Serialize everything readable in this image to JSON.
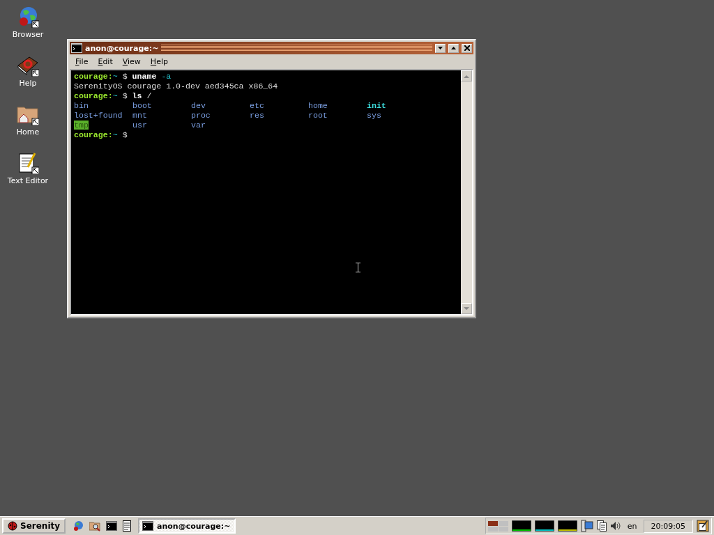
{
  "desktop_icons": [
    {
      "label": "Browser",
      "kind": "globe"
    },
    {
      "label": "Help",
      "kind": "book"
    },
    {
      "label": "Home",
      "kind": "folder"
    },
    {
      "label": "Text Editor",
      "kind": "notepad"
    }
  ],
  "window": {
    "title": "anon@courage:~",
    "menu": [
      "File",
      "Edit",
      "View",
      "Help"
    ],
    "terminal": {
      "lines": [
        [
          {
            "text": "courage:",
            "kind": "host"
          },
          {
            "text": "~",
            "kind": "path"
          },
          {
            "text": "$",
            "kind": "plain"
          },
          {
            "text": "uname",
            "kind": "command"
          },
          {
            "text": "-a",
            "kind": "arg"
          }
        ],
        [
          {
            "text": "SerenityOS courage 1.0-dev aed345ca x86_64",
            "kind": "plain"
          }
        ],
        [
          {
            "text": "courage:",
            "kind": "host"
          },
          {
            "text": "~",
            "kind": "path"
          },
          {
            "text": "$",
            "kind": "plain"
          },
          {
            "text": "ls",
            "kind": "command"
          },
          {
            "text": "/",
            "kind": "plain"
          }
        ],
        [
          {
            "text": "courage:",
            "kind": "host"
          },
          {
            "text": "~",
            "kind": "path"
          },
          {
            "text": "$",
            "kind": "plain"
          }
        ]
      ],
      "listing": [
        [
          {
            "text": "bin",
            "kind": "dir"
          },
          {
            "text": "boot",
            "kind": "dir"
          },
          {
            "text": "dev",
            "kind": "dir"
          },
          {
            "text": "etc",
            "kind": "dir"
          },
          {
            "text": "home",
            "kind": "dir"
          },
          {
            "text": "init",
            "kind": "exec"
          }
        ],
        [
          {
            "text": "lost+found",
            "kind": "dir"
          },
          {
            "text": "mnt",
            "kind": "dir"
          },
          {
            "text": "proc",
            "kind": "dir"
          },
          {
            "text": "res",
            "kind": "dir"
          },
          {
            "text": "root",
            "kind": "dir"
          },
          {
            "text": "sys",
            "kind": "dir"
          }
        ],
        [
          {
            "text": "tmp",
            "kind": "sticky"
          },
          {
            "text": "usr",
            "kind": "dir"
          },
          {
            "text": "var",
            "kind": "dir"
          }
        ]
      ]
    }
  },
  "taskbar": {
    "start": "Serenity",
    "quick_launch": [
      {
        "kind": "globe"
      },
      {
        "kind": "finder"
      },
      {
        "kind": "terminal"
      },
      {
        "kind": "notepad"
      }
    ],
    "tasks": [
      {
        "label": "anon@courage:~",
        "selected": true
      }
    ],
    "workspaces": [
      {
        "selected": true
      },
      {
        "selected": false
      },
      {
        "selected": false
      },
      {
        "selected": false
      }
    ],
    "graphs": [
      {
        "color": "#00c000"
      },
      {
        "color": "#00c0c0"
      },
      {
        "color": "#c0c000"
      }
    ],
    "keymap": "en",
    "clock": "20:09:05"
  }
}
